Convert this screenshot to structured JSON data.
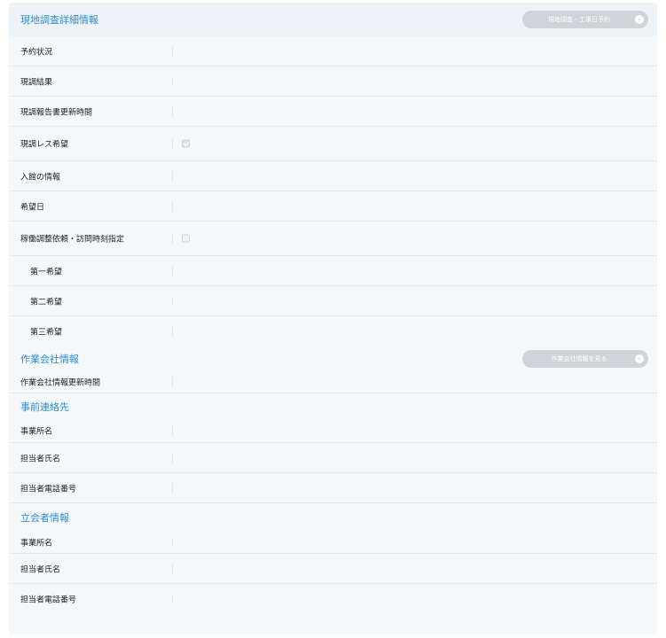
{
  "survey": {
    "title": "現地調査詳細情報",
    "button_label": "現地調査・工事日予約",
    "rows": {
      "reservation_status": "予約状況",
      "survey_result": "現調結果",
      "report_update_time": "現調報告書更新時間",
      "no_survey_wish": "現調レス希望",
      "building_entry_info": "入館の情報",
      "desired_date": "希望日",
      "visit_time_request": "稼働調整依頼・訪問時刻指定",
      "first_choice": "第一希望",
      "second_choice": "第二希望",
      "third_choice": "第三希望"
    },
    "no_survey_wish_checked": true,
    "visit_time_request_checked": false
  },
  "company": {
    "title": "作業会社情報",
    "button_label": "作業会社情報を見る",
    "rows": {
      "update_time": "作業会社情報更新時間"
    }
  },
  "prior_contact": {
    "title": "事前連絡先",
    "rows": {
      "office_name": "事業所名",
      "person_name": "担当者氏名",
      "person_phone": "担当者電話番号"
    }
  },
  "witness": {
    "title": "立会者情報",
    "rows": {
      "office_name": "事業所名",
      "person_name": "担当者氏名",
      "person_phone": "担当者電話番号"
    }
  }
}
